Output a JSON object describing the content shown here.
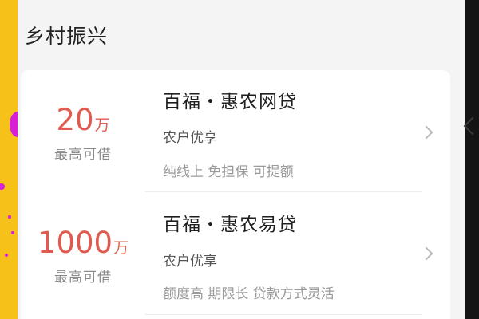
{
  "section": {
    "title": "乡村振兴"
  },
  "loans": [
    {
      "amount": "20",
      "unit": "万",
      "amount_label": "最高可借",
      "name": "百福・惠农网贷",
      "tag": "农户优享",
      "desc": "纯线上 免担保 可提额"
    },
    {
      "amount": "1000",
      "unit": "万",
      "amount_label": "最高可借",
      "name": "百福・惠农易贷",
      "tag": "农户优享",
      "desc": "额度高 期限长 贷款方式灵活"
    }
  ],
  "colors": {
    "amount": "#e05a4f",
    "background": "#f4f4f4",
    "card": "#ffffff",
    "left_banner": "#f6c21a"
  },
  "icons": {
    "row_arrow": "chevron-right-icon"
  }
}
